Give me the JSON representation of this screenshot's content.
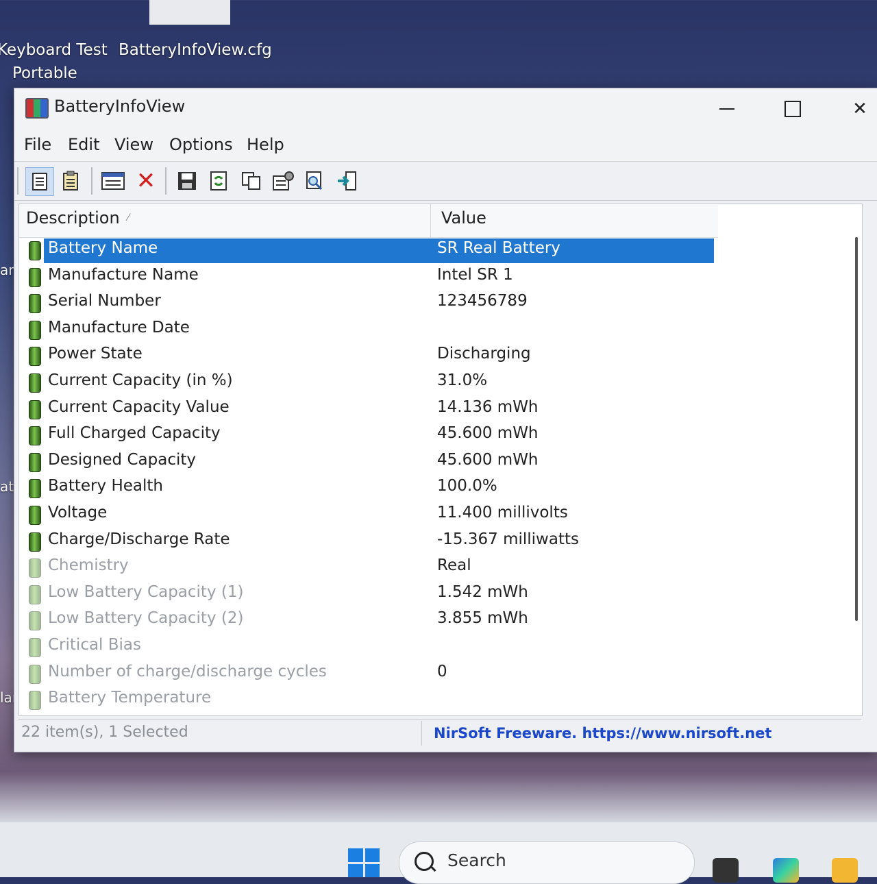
{
  "desktop": {
    "icons": [
      {
        "label_line1": "Keyboard Test",
        "label_line2": "Portable"
      },
      {
        "label_line1": "BatteryInfoView.cfg"
      }
    ],
    "edge_labels": [
      "am",
      "att",
      "lar"
    ]
  },
  "window": {
    "title": "BatteryInfoView",
    "controls": {
      "minimize": "—",
      "close": "✕"
    }
  },
  "menu": [
    "File",
    "Edit",
    "View",
    "Options",
    "Help"
  ],
  "toolbar": {
    "icons": [
      "report-icon",
      "clipboard-icon",
      "properties-icon",
      "delete-icon",
      "save-icon",
      "refresh-icon",
      "copy-icon",
      "options-icon",
      "find-icon",
      "exit-icon"
    ],
    "delete_glyph": "✕"
  },
  "list": {
    "columns": [
      "Description",
      "Value"
    ],
    "sort_indicator": "⁄",
    "rows": [
      {
        "description": "Battery Name",
        "value": "SR Real Battery",
        "selected": true
      },
      {
        "description": "Manufacture Name",
        "value": "Intel SR 1"
      },
      {
        "description": "Serial Number",
        "value": "123456789"
      },
      {
        "description": "Manufacture Date",
        "value": ""
      },
      {
        "description": "Power State",
        "value": "Discharging"
      },
      {
        "description": "Current Capacity (in %)",
        "value": "31.0%"
      },
      {
        "description": "Current Capacity Value",
        "value": "14.136 mWh"
      },
      {
        "description": "Full Charged Capacity",
        "value": "45.600 mWh"
      },
      {
        "description": "Designed Capacity",
        "value": "45.600 mWh"
      },
      {
        "description": "Battery Health",
        "value": "100.0%"
      },
      {
        "description": "Voltage",
        "value": "11.400 millivolts"
      },
      {
        "description": "Charge/Discharge Rate",
        "value": "-15.367 milliwatts"
      },
      {
        "description": "Chemistry",
        "value": "Real"
      },
      {
        "description": "Low Battery Capacity (1)",
        "value": "1.542 mWh"
      },
      {
        "description": "Low Battery Capacity (2)",
        "value": "3.855 mWh"
      },
      {
        "description": "Critical Bias",
        "value": ""
      },
      {
        "description": "Number of charge/discharge cycles",
        "value": "0"
      },
      {
        "description": "Battery Temperature",
        "value": ""
      }
    ]
  },
  "status": {
    "items": "22 item(s), 1 Selected",
    "link": "NirSoft Freeware. https://www.nirsoft.net"
  },
  "taskbar": {
    "search_placeholder": "Search"
  },
  "colors": {
    "selection": "#1f77d0",
    "link": "#1a48c9",
    "close_red": "#d02020"
  }
}
